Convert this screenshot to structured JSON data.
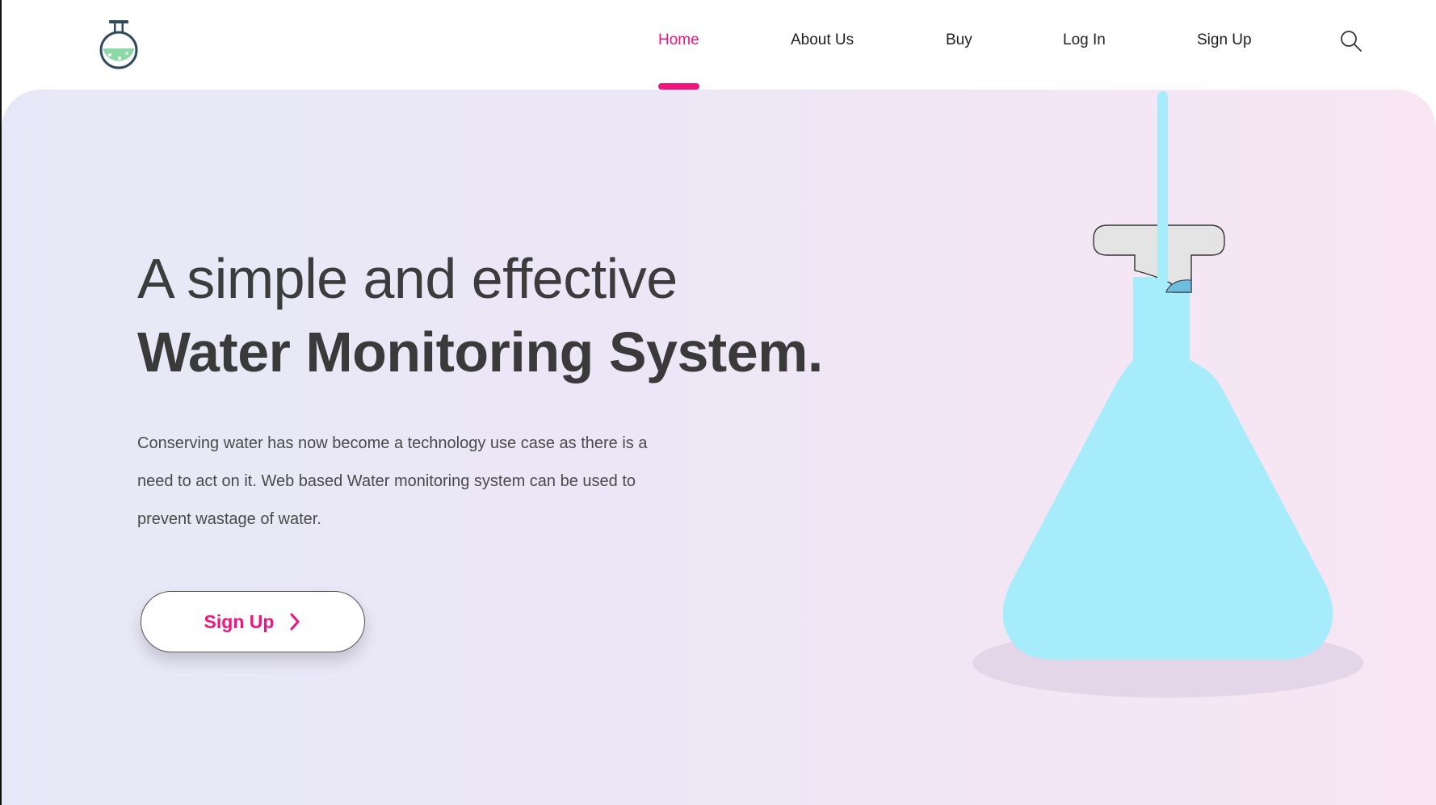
{
  "nav": {
    "items": [
      {
        "label": "Home",
        "active": true
      },
      {
        "label": "About Us",
        "active": false
      },
      {
        "label": "Buy",
        "active": false
      },
      {
        "label": "Log In",
        "active": false
      },
      {
        "label": "Sign Up",
        "active": false
      }
    ],
    "search_icon": "search-icon",
    "logo_icon": "flask-logo-icon"
  },
  "hero": {
    "line1": "A simple and effective",
    "line2": "Water Monitoring System.",
    "description": "Conserving water has now become a technology use case as there is a need to act on it.  Web based Water monitoring system can be used to prevent wastage of water.",
    "cta_label": "Sign Up",
    "illustration": "conical-flask-illustration"
  },
  "colors": {
    "accent": "#f0147c",
    "liquid": "#a6ecfb",
    "heading": "#3a3a3a"
  }
}
